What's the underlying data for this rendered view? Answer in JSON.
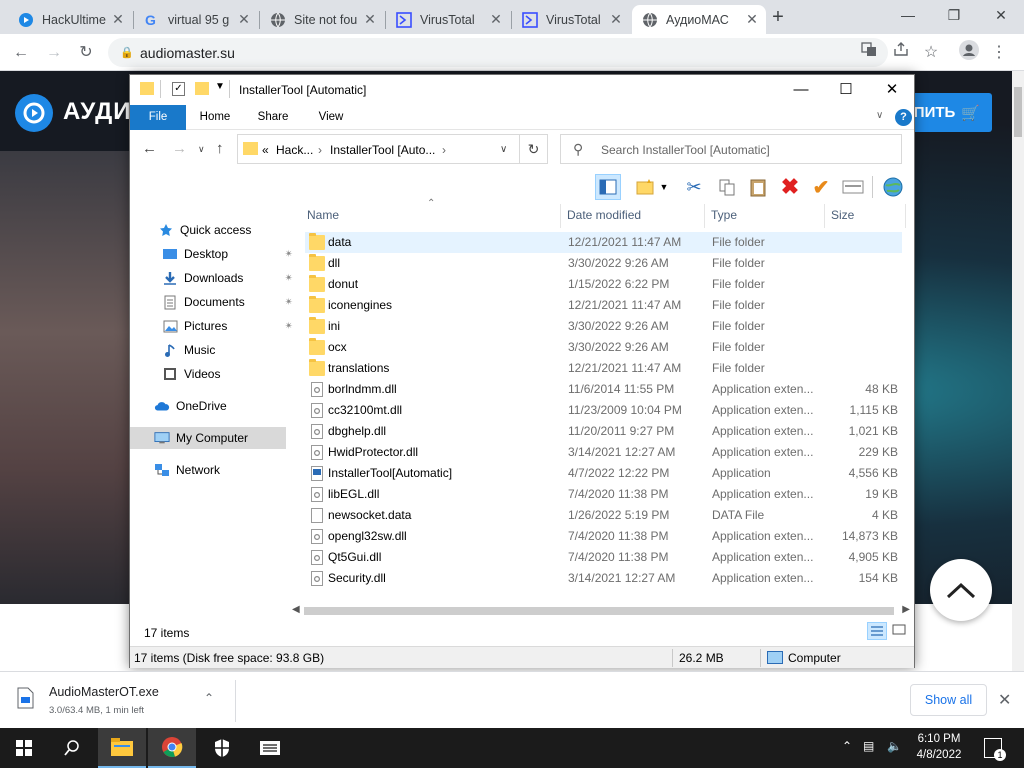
{
  "browser": {
    "tabs": [
      {
        "title": "HackUltime",
        "icon": "hackultimate-favicon"
      },
      {
        "title": "virtual 95 g",
        "icon": "google-favicon"
      },
      {
        "title": "Site not fou",
        "icon": "globe-favicon"
      },
      {
        "title": "VirusTotal",
        "icon": "virustotal-favicon"
      },
      {
        "title": "VirusTotal",
        "icon": "virustotal-favicon"
      },
      {
        "title": "АудиоМАС",
        "icon": "globe-favicon",
        "active": true
      }
    ],
    "url": "audiomaster.su"
  },
  "website": {
    "logo_text": "АУДИ",
    "buy_label": "ПИТЬ",
    "accent": "#1e88e5"
  },
  "explorer": {
    "title": "InstallerTool [Automatic]",
    "ribbon_tabs": [
      "File",
      "Home",
      "Share",
      "View"
    ],
    "breadcrumb": [
      "«",
      "Hack...",
      "InstallerTool [Auto..."
    ],
    "search_placeholder": "Search InstallerTool [Automatic]",
    "nav_pane": [
      {
        "label": "Quick access",
        "icon": "star-icon"
      },
      {
        "label": "Desktop",
        "icon": "desktop-icon",
        "pinned": true
      },
      {
        "label": "Downloads",
        "icon": "downloads-icon",
        "pinned": true
      },
      {
        "label": "Documents",
        "icon": "documents-icon",
        "pinned": true
      },
      {
        "label": "Pictures",
        "icon": "pictures-icon",
        "pinned": true
      },
      {
        "label": "Music",
        "icon": "music-icon"
      },
      {
        "label": "Videos",
        "icon": "videos-icon"
      },
      {
        "label": "OneDrive",
        "icon": "onedrive-icon"
      },
      {
        "label": "My Computer",
        "icon": "computer-icon",
        "selected": true
      },
      {
        "label": "Network",
        "icon": "network-icon"
      }
    ],
    "columns": [
      "Name",
      "Date modified",
      "Type",
      "Size"
    ],
    "files": [
      {
        "name": "data",
        "date": "12/21/2021 11:47 AM",
        "type": "File folder",
        "size": "",
        "kind": "folder"
      },
      {
        "name": "dll",
        "date": "3/30/2022 9:26 AM",
        "type": "File folder",
        "size": "",
        "kind": "folder"
      },
      {
        "name": "donut",
        "date": "1/15/2022 6:22 PM",
        "type": "File folder",
        "size": "",
        "kind": "folder"
      },
      {
        "name": "iconengines",
        "date": "12/21/2021 11:47 AM",
        "type": "File folder",
        "size": "",
        "kind": "folder"
      },
      {
        "name": "ini",
        "date": "3/30/2022 9:26 AM",
        "type": "File folder",
        "size": "",
        "kind": "folder"
      },
      {
        "name": "ocx",
        "date": "3/30/2022 9:26 AM",
        "type": "File folder",
        "size": "",
        "kind": "folder"
      },
      {
        "name": "translations",
        "date": "12/21/2021 11:47 AM",
        "type": "File folder",
        "size": "",
        "kind": "folder"
      },
      {
        "name": "borlndmm.dll",
        "date": "11/6/2014 11:55 PM",
        "type": "Application exten...",
        "size": "48 KB",
        "kind": "dll"
      },
      {
        "name": "cc32100mt.dll",
        "date": "11/23/2009 10:04 PM",
        "type": "Application exten...",
        "size": "1,115 KB",
        "kind": "dll"
      },
      {
        "name": "dbghelp.dll",
        "date": "11/20/2011 9:27 PM",
        "type": "Application exten...",
        "size": "1,021 KB",
        "kind": "dll"
      },
      {
        "name": "HwidProtector.dll",
        "date": "3/14/2021 12:27 AM",
        "type": "Application exten...",
        "size": "229 KB",
        "kind": "dll"
      },
      {
        "name": "InstallerTool[Automatic]",
        "date": "4/7/2022 12:22 PM",
        "type": "Application",
        "size": "4,556 KB",
        "kind": "exe"
      },
      {
        "name": "libEGL.dll",
        "date": "7/4/2020 11:38 PM",
        "type": "Application exten...",
        "size": "19 KB",
        "kind": "dll"
      },
      {
        "name": "newsocket.data",
        "date": "1/26/2022 5:19 PM",
        "type": "DATA File",
        "size": "4 KB",
        "kind": "file"
      },
      {
        "name": "opengl32sw.dll",
        "date": "7/4/2020 11:38 PM",
        "type": "Application exten...",
        "size": "14,873 KB",
        "kind": "dll"
      },
      {
        "name": "Qt5Gui.dll",
        "date": "7/4/2020 11:38 PM",
        "type": "Application exten...",
        "size": "4,905 KB",
        "kind": "dll"
      },
      {
        "name": "Security.dll",
        "date": "3/14/2021 12:27 AM",
        "type": "Application exten...",
        "size": "154 KB",
        "kind": "dll"
      }
    ],
    "item_count": "17 items",
    "status": {
      "items": "17 items (Disk free space: 93.8 GB)",
      "size": "26.2 MB",
      "location": "Computer"
    }
  },
  "download": {
    "filename": "AudioMasterOT.exe",
    "status": "3.0/63.4 MB, 1 min left",
    "show_all": "Show all"
  },
  "taskbar": {
    "time": "6:10 PM",
    "date": "4/8/2022",
    "notification_count": "1"
  }
}
